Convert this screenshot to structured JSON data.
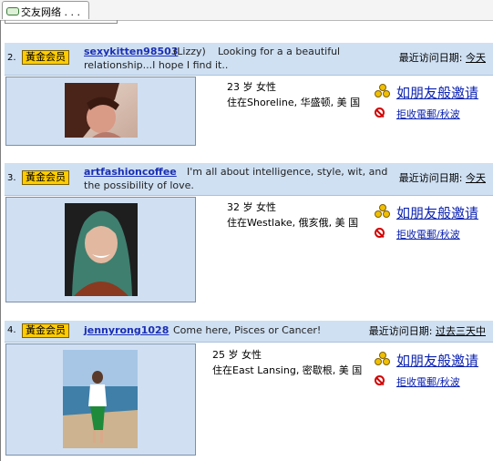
{
  "tab": {
    "label": "交友网络 . . . "
  },
  "listings": [
    {
      "index": "2.",
      "badge": "黃金会员",
      "username": "sexykitten98503",
      "nickname": "(Lizzy)",
      "headline": "Looking for a a beautiful relationship...I hope I find it..",
      "visit_label": "最近访问日期:",
      "visit_value": "今天",
      "age_gender": "23 岁  女性",
      "location": "住在Shoreline, 华盛顿, 美 国",
      "invite_label": "如朋友般邀请",
      "reject_label": "拒收電郵/秋波"
    },
    {
      "index": "3.",
      "badge": "黃金会员",
      "username": "artfashioncoffee",
      "headline": "I'm all about intelligence, style, wit, and the possibility of love.",
      "visit_label": "最近访问日期:",
      "visit_value": "今天",
      "age_gender": "32 岁  女性",
      "location": "住在Westlake, 俄亥俄, 美 国",
      "invite_label": "如朋友般邀请",
      "reject_label": "拒收電郵/秋波"
    },
    {
      "index": "4.",
      "badge": "黃金会员",
      "username": "jennyrong1028",
      "headline": "Come here, Pisces or Cancer!",
      "visit_label": "最近访问日期:",
      "visit_value": "过去三天中",
      "age_gender": "25 岁  女性",
      "location": "住在East Lansing, 密歇根, 美 国",
      "invite_label": "如朋友般邀请",
      "reject_label": "拒收電郵/秋波"
    }
  ],
  "colors": {
    "header_bg": "#cfe0f3",
    "badge_bg": "#ffcc00",
    "link": "#1b2fb5"
  }
}
